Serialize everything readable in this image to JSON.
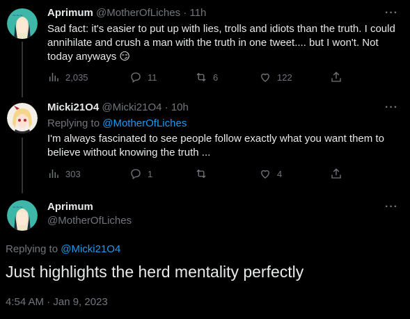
{
  "tweets": [
    {
      "name": "Aprimum",
      "handle": "@MotherOfLiches",
      "dot": "·",
      "time": "11h",
      "text": "Sad fact: it's easier to put up with lies, trolls and idiots than the truth. I could annihilate and crush a man with the truth in one tweet.... but I won't. Not today anyways",
      "emoji": "😏",
      "views": "2,035",
      "replies": "11",
      "retweets": "6",
      "likes": "122"
    },
    {
      "name": "Micki21O4",
      "handle": "@Micki21O4",
      "dot": "·",
      "time": "10h",
      "replying_prefix": "Replying to ",
      "replying_to": "@MotherOfLiches",
      "text": "I'm always fascinated to see people follow exactly what you want them to believe without knowing the truth ...",
      "views": "303",
      "replies": "1",
      "retweets": "",
      "likes": "4"
    }
  ],
  "main": {
    "name": "Aprimum",
    "handle": "@MotherOfLiches",
    "replying_prefix": "Replying to ",
    "replying_to": "@Micki21O4",
    "text": "Just highlights the herd mentality perfectly",
    "timestamp": "4:54 AM · Jan 9, 2023"
  },
  "more_glyph": "···",
  "colors": {
    "accent": "#1d9bf0",
    "secondary": "#71767b",
    "primary": "#e7e9ea",
    "background": "#000000"
  }
}
